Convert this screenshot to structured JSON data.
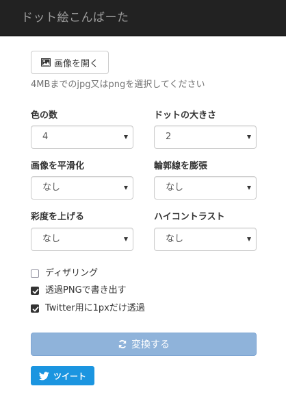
{
  "app": {
    "title": "ドット絵こんばーた"
  },
  "open_button": {
    "label": "画像を開く",
    "icon": "image-icon"
  },
  "hint": "4MBまでのjpg又はpngを選択してください",
  "settings": {
    "color_count": {
      "label": "色の数",
      "value": "4"
    },
    "dot_size": {
      "label": "ドットの大きさ",
      "value": "2"
    },
    "smoothing": {
      "label": "画像を平滑化",
      "value": "なし"
    },
    "outline_expand": {
      "label": "輪郭線を膨張",
      "value": "なし"
    },
    "saturation": {
      "label": "彩度を上げる",
      "value": "なし"
    },
    "high_contrast": {
      "label": "ハイコントラスト",
      "value": "なし"
    }
  },
  "options": [
    {
      "label": "ディザリング",
      "checked": false
    },
    {
      "label": "透過PNGで書き出す",
      "checked": true
    },
    {
      "label": "Twitter用に1pxだけ透過",
      "checked": true
    }
  ],
  "convert_button": {
    "label": "変換する",
    "icon": "refresh-icon",
    "enabled": false
  },
  "tweet_button": {
    "label": "ツイート",
    "icon": "twitter-bird-icon"
  },
  "colors": {
    "navbar_bg": "#222222",
    "brand_text": "#9d9d9d",
    "convert_bg": "#8fb3da",
    "tweet_bg": "#1b95e0"
  }
}
